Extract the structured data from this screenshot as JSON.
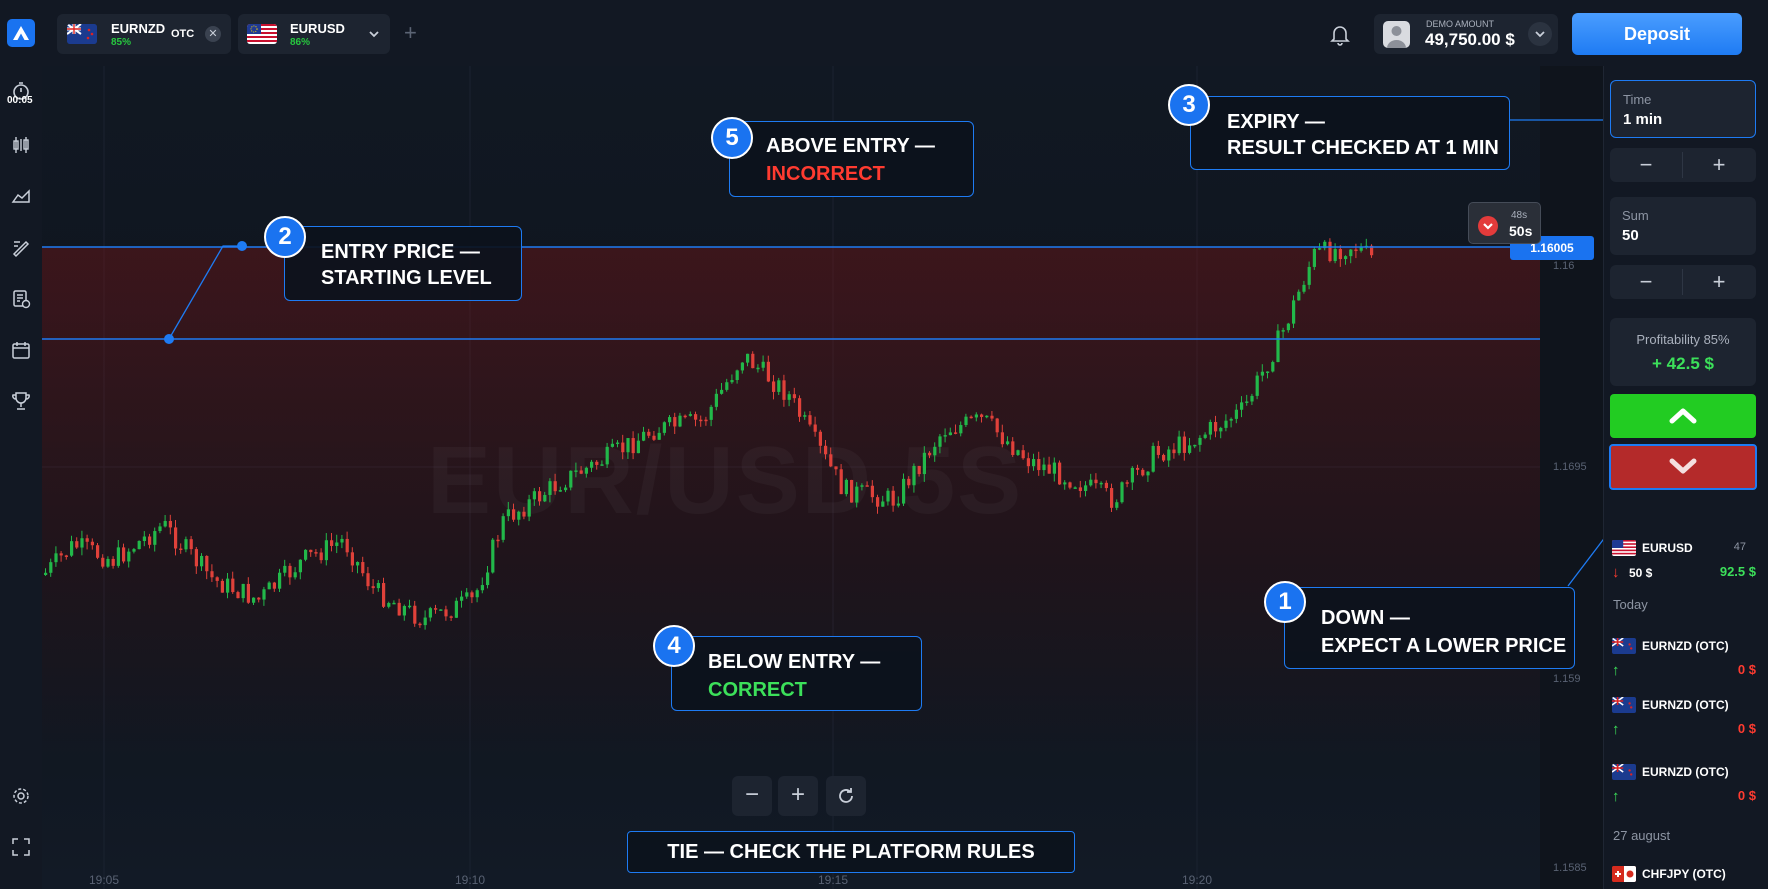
{
  "tabs": [
    {
      "name": "EURNZD",
      "payout": "85%",
      "badge": "OTC"
    },
    {
      "name": "EURUSD",
      "payout": "86%"
    }
  ],
  "account": {
    "label": "DEMO AMOUNT",
    "amount": "49,750.00 $"
  },
  "deposit_label": "Deposit",
  "timer": "00:05",
  "chart": {
    "watermark": "EUR/USD 5S",
    "y_ticks": [
      "1.16",
      "1.1695",
      "1.159",
      "1.1585"
    ],
    "x_ticks": [
      "19:05",
      "19:10",
      "19:15",
      "19:20"
    ],
    "current_price": "1.16005",
    "countdown_small": "48s",
    "countdown_main": "50s"
  },
  "callouts": [
    {
      "num": "1",
      "line1": "DOWN —",
      "line2": "EXPECT A LOWER PRICE"
    },
    {
      "num": "2",
      "line1": "ENTRY PRICE —",
      "line2": "STARTING LEVEL"
    },
    {
      "num": "3",
      "line1": "EXPIRY —",
      "line2": "RESULT CHECKED AT 1 MIN"
    },
    {
      "num": "4",
      "line1": "BELOW ENTRY —",
      "line2": "CORRECT"
    },
    {
      "num": "5",
      "line1": "ABOVE ENTRY —",
      "line2": "INCORRECT"
    }
  ],
  "tie_text": "TIE — CHECK THE PLATFORM RULES",
  "colors": {
    "correct": "#3ce05a",
    "incorrect": "#ff3b30",
    "accent": "#1e7bf3",
    "up": "#22cc22",
    "down": "#b42a2a"
  },
  "panel": {
    "time_label": "Time",
    "time_value": "1 min",
    "sum_label": "Sum",
    "sum_value": "50",
    "profit_label": "Profitability 85%",
    "profit_value": "+ 42.5 $"
  },
  "trades": {
    "active": {
      "name": "EURUSD",
      "count": "47",
      "amount": "50 $",
      "payout": "92.5 $"
    },
    "today_label": "Today",
    "today": [
      {
        "name": "EURNZD (OTC)",
        "amount": "0 $"
      },
      {
        "name": "EURNZD (OTC)",
        "amount": "0 $"
      },
      {
        "name": "EURNZD (OTC)",
        "amount": "0 $"
      }
    ],
    "date_label": "27 august",
    "dated": [
      {
        "name": "CHFJPY (OTC)"
      }
    ]
  }
}
